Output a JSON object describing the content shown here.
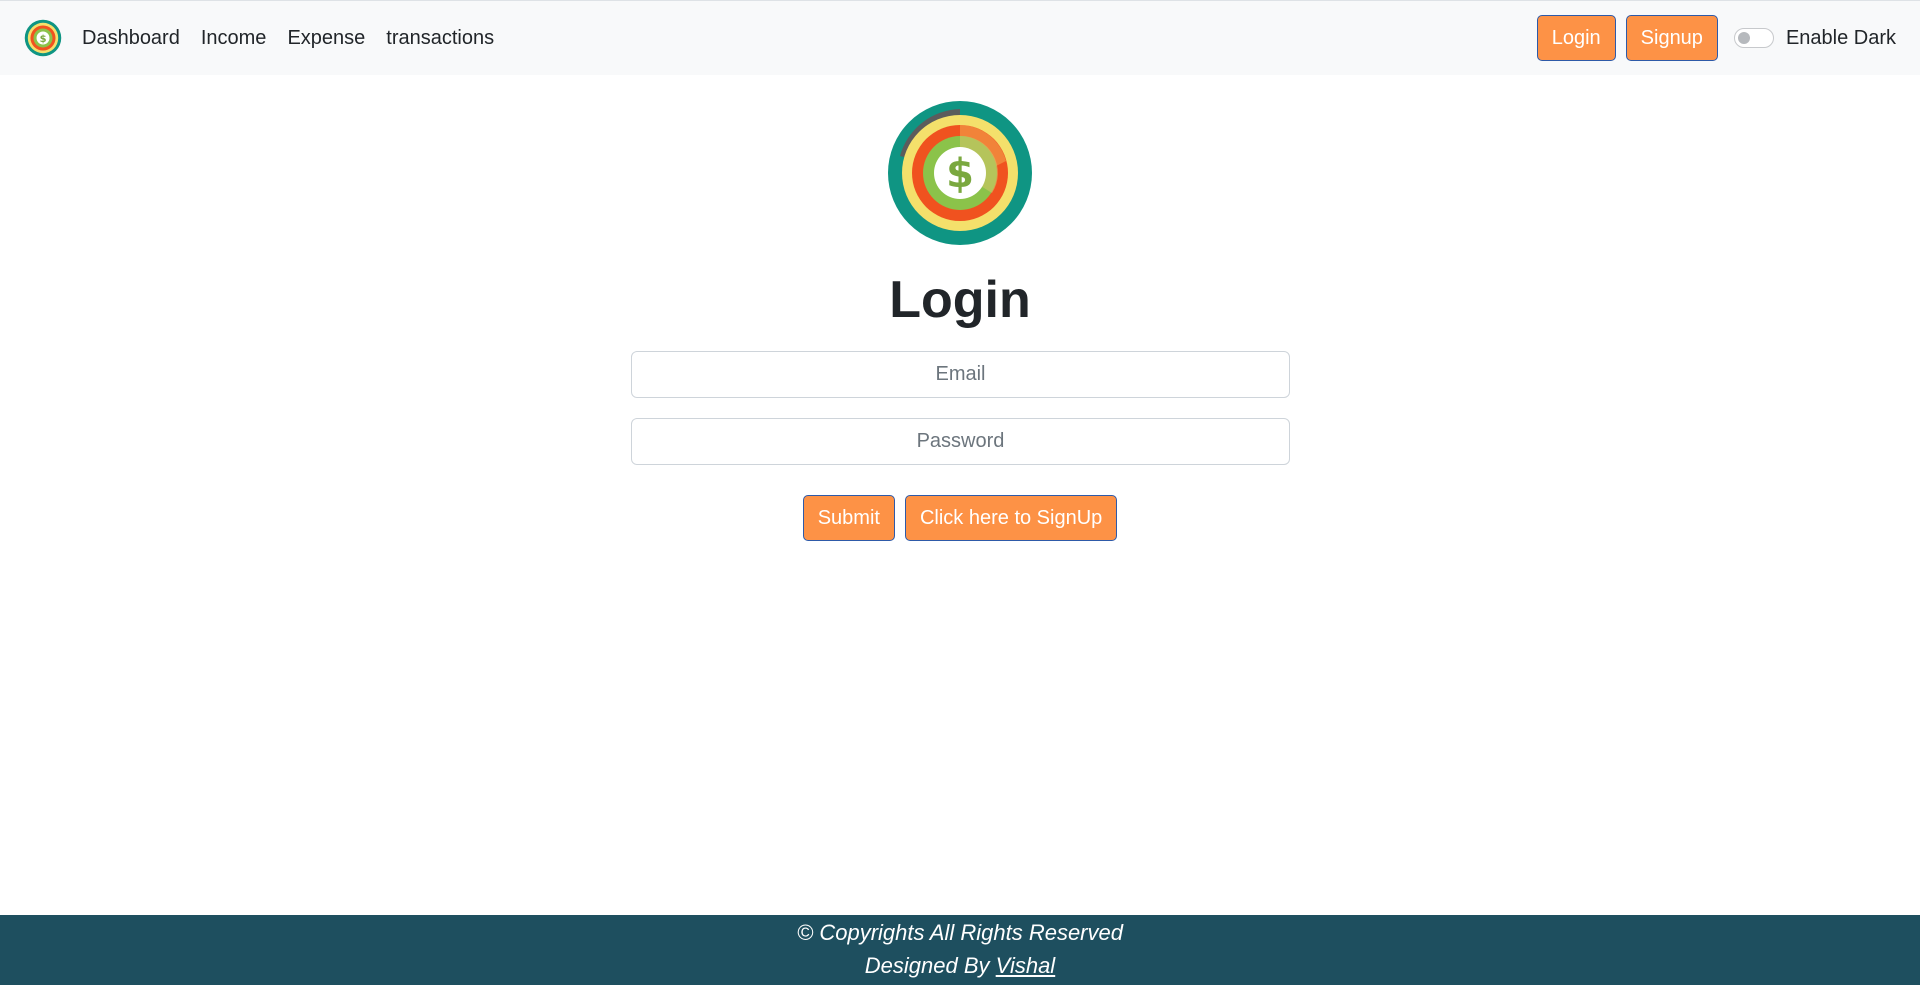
{
  "nav": {
    "items": [
      "Dashboard",
      "Income",
      "Expense",
      "transactions"
    ],
    "login_label": "Login",
    "signup_label": "Signup",
    "dark_mode_label": "Enable Dark",
    "dark_mode_on": false
  },
  "main": {
    "title": "Login",
    "email_placeholder": "Email",
    "password_placeholder": "Password",
    "submit_label": "Submit",
    "signup_link_label": "Click here to SignUp"
  },
  "footer": {
    "copyright": "© Copyrights All Rights Reserved",
    "designed_by_prefix": "Designed By",
    "designer_name": "Vishal"
  },
  "colors": {
    "accent": "#fd9246",
    "footer_bg": "#1e4f5f",
    "navbar_bg": "#f8f9fa"
  },
  "icons": {
    "brand": "dollar-coin-logo-icon"
  }
}
